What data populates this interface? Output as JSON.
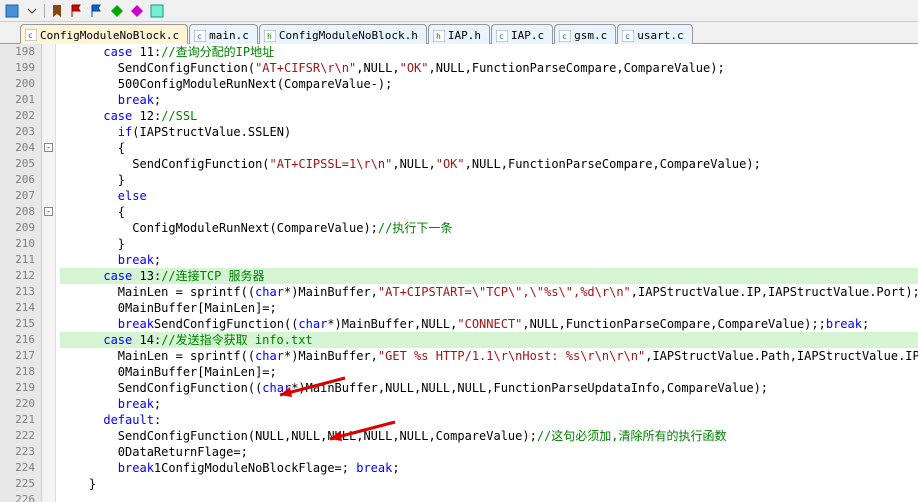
{
  "tabs": [
    {
      "label": "ConfigModuleNoBlock.c",
      "active": true
    },
    {
      "label": "main.c",
      "active": false
    },
    {
      "label": "ConfigModuleNoBlock.h",
      "active": false
    },
    {
      "label": "IAP.h",
      "active": false
    },
    {
      "label": "IAP.c",
      "active": false
    },
    {
      "label": "gsm.c",
      "active": false
    },
    {
      "label": "usart.c",
      "active": false
    }
  ],
  "lineStart": 198,
  "lineEnd": 226,
  "lines": {
    "l198": {
      "pre": "      ",
      "kw": "case",
      "sp": " ",
      "n": "11",
      "col": ":",
      "cmt": "//查询分配的IP地址"
    },
    "l199": {
      "pre": "        ",
      "fn": "SendConfigFunction",
      "open": "(",
      "s1": "\"AT+CIFSR\\r\\n\"",
      "mid": ",NULL,",
      "s2": "\"OK\"",
      "rest": ",NULL,FunctionParseCompare,CompareValue);"
    },
    "l200": {
      "pre": "        ",
      "fn": "ConfigModuleRunNext",
      "open": "(CompareValue-",
      "n": "500",
      "close": ");"
    },
    "l201": {
      "pre": "        ",
      "kw": "break",
      "semi": ";"
    },
    "l202": {
      "pre": "      ",
      "kw": "case",
      "sp": " ",
      "n": "12",
      "col": ":",
      "cmt": "//SSL"
    },
    "l203": {
      "pre": "        ",
      "kw": "if",
      "rest": "(IAPStructValue.SSLEN)"
    },
    "l204": {
      "pre": "        ",
      "txt": "{"
    },
    "l205": {
      "pre": "          ",
      "fn": "SendConfigFunction",
      "open": "(",
      "s1": "\"AT+CIPSSL=1\\r\\n\"",
      "mid": ",NULL,",
      "s2": "\"OK\"",
      "rest": ",NULL,FunctionParseCompare,CompareValue);"
    },
    "l206": {
      "pre": "        ",
      "txt": "}"
    },
    "l207": {
      "pre": "        ",
      "kw": "else"
    },
    "l208": {
      "pre": "        ",
      "txt": "{"
    },
    "l209": {
      "pre": "          ",
      "fn": "ConfigModuleRunNext",
      "open": "(CompareValue);",
      "cmt": "//执行下一条"
    },
    "l210": {
      "pre": "        ",
      "txt": "}"
    },
    "l211": {
      "pre": "        ",
      "kw": "break",
      "semi": ";"
    },
    "l212": {
      "pre": "      ",
      "kw": "case",
      "sp": " ",
      "n": "13",
      "col": ":",
      "cmt": "//连接TCP 服务器"
    },
    "l213": {
      "pre": "        ",
      "fn": "MainLen = sprintf",
      "open": "((",
      "cast": "char",
      "rest1": "*)MainBuffer,",
      "s1": "\"AT+CIPSTART=\\\"TCP\\\",\\\"%s\\\",%d\\r\\n\"",
      "rest2": ",IAPStructValue.IP,IAPStructValue.Port);"
    },
    "l214": {
      "pre": "        ",
      "txt": "MainBuffer[MainLen]=",
      "n": "0",
      "semi": ";"
    },
    "l215": {
      "pre": "        ",
      "fn": "SendConfigFunction",
      "open": "((",
      "cast": "char",
      "rest1": "*)MainBuffer,NULL,",
      "s1": "\"CONNECT\"",
      "rest2": ",NULL,FunctionParseCompare,CompareValue);",
      "kw": "break",
      "semi": ";"
    },
    "l216": {
      "pre": "      ",
      "kw": "case",
      "sp": " ",
      "n": "14",
      "col": ":",
      "cmt": "//发送指令获取 info.txt"
    },
    "l217": {
      "pre": "        ",
      "fn": "MainLen = sprintf",
      "open": "((",
      "cast": "char",
      "rest1": "*)MainBuffer,",
      "s1": "\"GET %s HTTP/1.1\\r\\nHost: %s\\r\\n\\r\\n\"",
      "rest2": ",IAPStructValue.Path,IAPStructValue.IP);"
    },
    "l218": {
      "pre": "        ",
      "txt": "MainBuffer[MainLen]=",
      "n": "0",
      "semi": ";"
    },
    "l219": {
      "pre": "        ",
      "fn": "SendConfigFunction",
      "open": "((",
      "cast": "char",
      "rest1": "*)MainBuffer,NULL,NULL,NULL,FunctionParseUpdataInfo,CompareValue);"
    },
    "l220": {
      "pre": "        ",
      "kw": "break",
      "semi": ";"
    },
    "l221": {
      "pre": "      ",
      "kw": "default",
      "col": ":"
    },
    "l222": {
      "pre": "        ",
      "fn": "SendConfigFunction",
      "open": "(NULL,NULL,NULL,NULL,NULL,CompareValue);",
      "cmt": "//这句必须加,清除所有的执行函数"
    },
    "l223": {
      "pre": "        ",
      "txt": "DataReturnFlage=",
      "n": "0",
      "semi": ";"
    },
    "l224": {
      "pre": "        ",
      "txt": "ConfigModuleNoBlockFlage=",
      "n": "1",
      "semi": "; ",
      "kw": "break",
      "semi2": ";"
    },
    "l225": {
      "pre": "    ",
      "txt": "}"
    }
  }
}
